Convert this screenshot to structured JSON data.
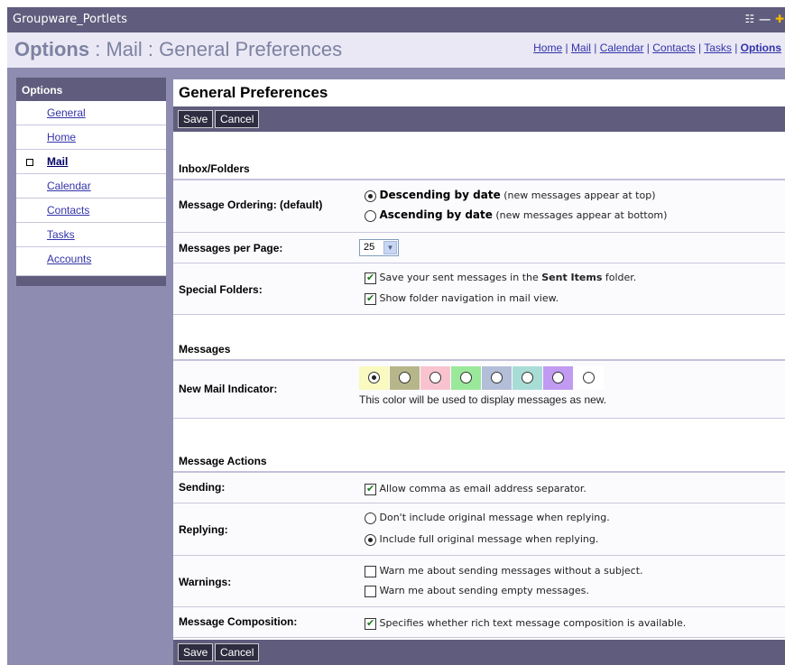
{
  "window": {
    "title": "Groupware_Portlets",
    "controls": "☷ — ✚"
  },
  "header": {
    "crumb_first": "Options",
    "crumb_rest": " : Mail : General Preferences",
    "links": [
      "Home",
      "Mail",
      "Calendar",
      "Contacts",
      "Tasks",
      "Options"
    ],
    "separator": " | "
  },
  "sidebar": {
    "title": "Options",
    "items": [
      {
        "label": "General",
        "active": false
      },
      {
        "label": "Home",
        "active": false
      },
      {
        "label": "Mail",
        "active": true
      },
      {
        "label": "Calendar",
        "active": false
      },
      {
        "label": "Contacts",
        "active": false
      },
      {
        "label": "Tasks",
        "active": false
      },
      {
        "label": "Accounts",
        "active": false
      }
    ]
  },
  "main": {
    "title": "General Preferences",
    "save_label": "Save",
    "cancel_label": "Cancel",
    "sections": {
      "inbox": "Inbox/Folders",
      "messages": "Messages",
      "actions": "Message Actions"
    },
    "ordering": {
      "label": "Message Ordering: (default)",
      "options": [
        {
          "main": "Descending by date",
          "note": " (new messages appear at top)",
          "checked": true
        },
        {
          "main": "Ascending by date",
          "note": " (new messages appear at bottom)",
          "checked": false
        }
      ]
    },
    "per_page": {
      "label": "Messages per Page:",
      "value": "25"
    },
    "special": {
      "label": "Special Folders:",
      "opt1_pre": "Save your sent messages in the ",
      "opt1_strong": "Sent Items",
      "opt1_post": " folder.",
      "opt1_checked": true,
      "opt2": "Show folder navigation in mail view.",
      "opt2_checked": true
    },
    "indicator": {
      "label": "New Mail Indicator:",
      "colors": [
        "#f9f9c0",
        "#b6b68a",
        "#f8c3cf",
        "#9ae89a",
        "#b3bed8",
        "#a8ddd6",
        "#c19af2",
        "#ffffff"
      ],
      "selected_index": 0,
      "note": "This color will be used to display messages as new."
    },
    "sending": {
      "label": "Sending:",
      "option": "Allow comma as email address separator.",
      "checked": true
    },
    "replying": {
      "label": "Replying:",
      "options": [
        {
          "text": "Don't include original message when replying.",
          "checked": false
        },
        {
          "text": "Include full original message when replying.",
          "checked": true
        }
      ]
    },
    "warnings": {
      "label": "Warnings:",
      "options": [
        {
          "text": "Warn me about sending messages without a subject.",
          "checked": false
        },
        {
          "text": "Warn me about sending empty messages.",
          "checked": false
        }
      ]
    },
    "composition": {
      "label": "Message Composition:",
      "option": "Specifies whether rich text message composition is available.",
      "checked": true
    }
  }
}
